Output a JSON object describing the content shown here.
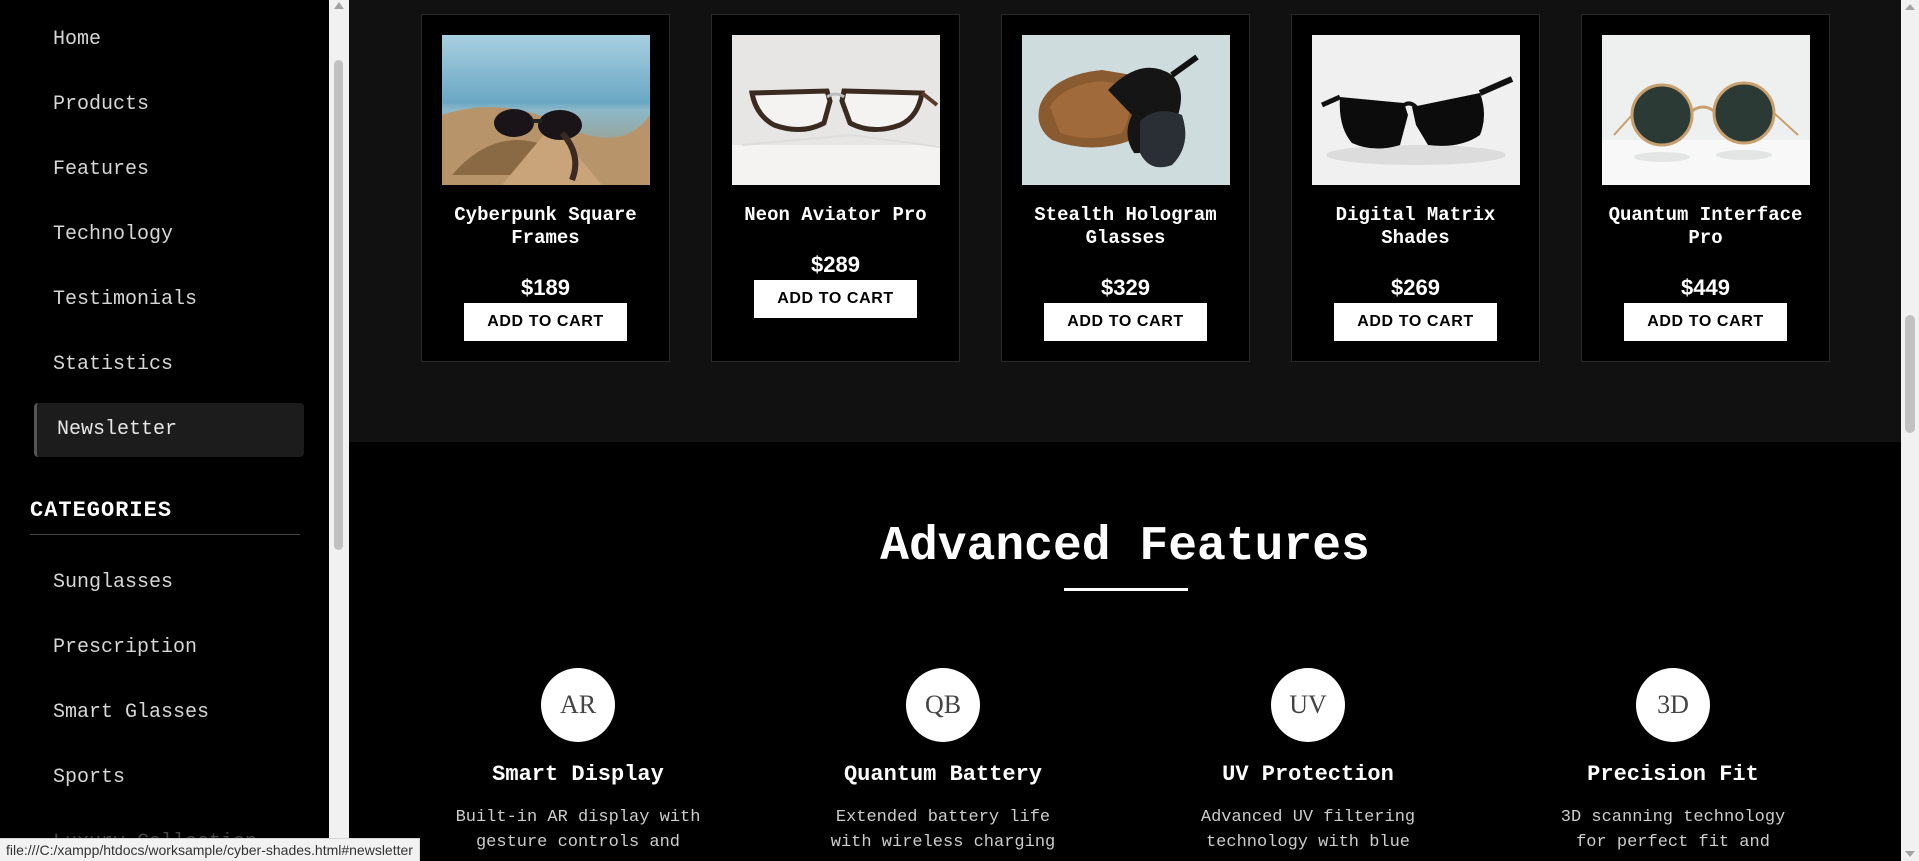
{
  "sidebar": {
    "nav": [
      {
        "label": "Home"
      },
      {
        "label": "Products"
      },
      {
        "label": "Features"
      },
      {
        "label": "Technology"
      },
      {
        "label": "Testimonials"
      },
      {
        "label": "Statistics"
      },
      {
        "label": "Newsletter",
        "active": true
      }
    ],
    "categories_heading": "CATEGORIES",
    "categories": [
      {
        "label": "Sunglasses"
      },
      {
        "label": "Prescription"
      },
      {
        "label": "Smart Glasses"
      },
      {
        "label": "Sports"
      },
      {
        "label": "Luxury Collection"
      }
    ]
  },
  "products": [
    {
      "name": "Cyberpunk Square Frames",
      "price": "$189",
      "button": "ADD TO CART",
      "image": "sunglasses-on-sand"
    },
    {
      "name": "Neon Aviator Pro",
      "price": "$289",
      "button": "ADD TO CART",
      "image": "clear-browline-glasses"
    },
    {
      "name": "Stealth Hologram Glasses",
      "price": "$329",
      "button": "ADD TO CART",
      "image": "sunglasses-with-brown-case"
    },
    {
      "name": "Digital Matrix Shades",
      "price": "$269",
      "button": "ADD TO CART",
      "image": "black-wayfarer-sunglasses"
    },
    {
      "name": "Quantum Interface Pro",
      "price": "$449",
      "button": "ADD TO CART",
      "image": "round-gold-sunglasses"
    }
  ],
  "features_section": {
    "title": "Advanced Features",
    "items": [
      {
        "badge": "AR",
        "title": "Smart Display",
        "desc": "Built-in AR display with gesture controls and"
      },
      {
        "badge": "QB",
        "title": "Quantum Battery",
        "desc": "Extended battery life with wireless charging"
      },
      {
        "badge": "UV",
        "title": "UV Protection",
        "desc": "Advanced UV filtering technology with blue"
      },
      {
        "badge": "3D",
        "title": "Precision Fit",
        "desc": "3D scanning technology for perfect fit and"
      }
    ]
  },
  "status_bar": {
    "url": "file:///C:/xampp/htdocs/worksample/cyber-shades.html#newsletter"
  },
  "colors": {
    "background": "#000000",
    "panel": "#111111",
    "text": "#ffffff",
    "button_bg": "#ffffff",
    "button_text": "#000000"
  }
}
